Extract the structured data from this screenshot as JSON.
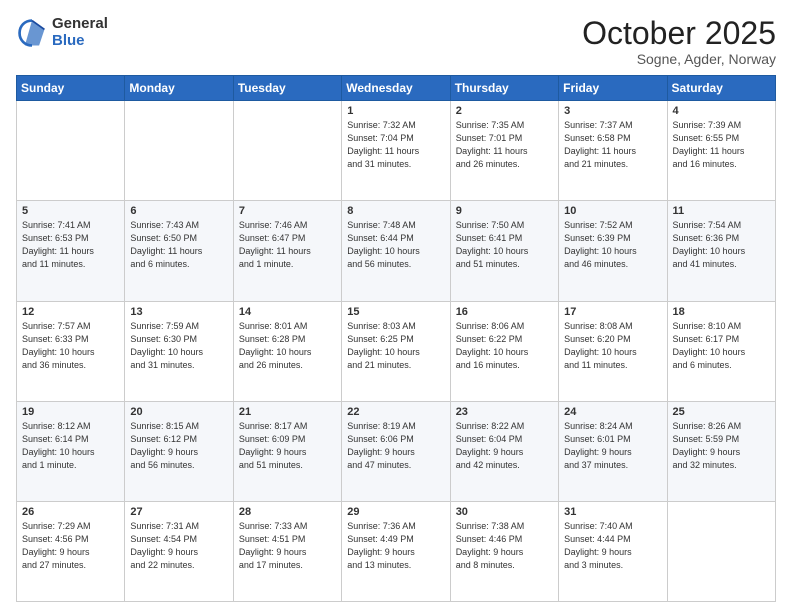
{
  "logo": {
    "general": "General",
    "blue": "Blue"
  },
  "header": {
    "month": "October 2025",
    "location": "Sogne, Agder, Norway"
  },
  "days_of_week": [
    "Sunday",
    "Monday",
    "Tuesday",
    "Wednesday",
    "Thursday",
    "Friday",
    "Saturday"
  ],
  "weeks": [
    [
      {
        "day": "",
        "info": ""
      },
      {
        "day": "",
        "info": ""
      },
      {
        "day": "",
        "info": ""
      },
      {
        "day": "1",
        "info": "Sunrise: 7:32 AM\nSunset: 7:04 PM\nDaylight: 11 hours\nand 31 minutes."
      },
      {
        "day": "2",
        "info": "Sunrise: 7:35 AM\nSunset: 7:01 PM\nDaylight: 11 hours\nand 26 minutes."
      },
      {
        "day": "3",
        "info": "Sunrise: 7:37 AM\nSunset: 6:58 PM\nDaylight: 11 hours\nand 21 minutes."
      },
      {
        "day": "4",
        "info": "Sunrise: 7:39 AM\nSunset: 6:55 PM\nDaylight: 11 hours\nand 16 minutes."
      }
    ],
    [
      {
        "day": "5",
        "info": "Sunrise: 7:41 AM\nSunset: 6:53 PM\nDaylight: 11 hours\nand 11 minutes."
      },
      {
        "day": "6",
        "info": "Sunrise: 7:43 AM\nSunset: 6:50 PM\nDaylight: 11 hours\nand 6 minutes."
      },
      {
        "day": "7",
        "info": "Sunrise: 7:46 AM\nSunset: 6:47 PM\nDaylight: 11 hours\nand 1 minute."
      },
      {
        "day": "8",
        "info": "Sunrise: 7:48 AM\nSunset: 6:44 PM\nDaylight: 10 hours\nand 56 minutes."
      },
      {
        "day": "9",
        "info": "Sunrise: 7:50 AM\nSunset: 6:41 PM\nDaylight: 10 hours\nand 51 minutes."
      },
      {
        "day": "10",
        "info": "Sunrise: 7:52 AM\nSunset: 6:39 PM\nDaylight: 10 hours\nand 46 minutes."
      },
      {
        "day": "11",
        "info": "Sunrise: 7:54 AM\nSunset: 6:36 PM\nDaylight: 10 hours\nand 41 minutes."
      }
    ],
    [
      {
        "day": "12",
        "info": "Sunrise: 7:57 AM\nSunset: 6:33 PM\nDaylight: 10 hours\nand 36 minutes."
      },
      {
        "day": "13",
        "info": "Sunrise: 7:59 AM\nSunset: 6:30 PM\nDaylight: 10 hours\nand 31 minutes."
      },
      {
        "day": "14",
        "info": "Sunrise: 8:01 AM\nSunset: 6:28 PM\nDaylight: 10 hours\nand 26 minutes."
      },
      {
        "day": "15",
        "info": "Sunrise: 8:03 AM\nSunset: 6:25 PM\nDaylight: 10 hours\nand 21 minutes."
      },
      {
        "day": "16",
        "info": "Sunrise: 8:06 AM\nSunset: 6:22 PM\nDaylight: 10 hours\nand 16 minutes."
      },
      {
        "day": "17",
        "info": "Sunrise: 8:08 AM\nSunset: 6:20 PM\nDaylight: 10 hours\nand 11 minutes."
      },
      {
        "day": "18",
        "info": "Sunrise: 8:10 AM\nSunset: 6:17 PM\nDaylight: 10 hours\nand 6 minutes."
      }
    ],
    [
      {
        "day": "19",
        "info": "Sunrise: 8:12 AM\nSunset: 6:14 PM\nDaylight: 10 hours\nand 1 minute."
      },
      {
        "day": "20",
        "info": "Sunrise: 8:15 AM\nSunset: 6:12 PM\nDaylight: 9 hours\nand 56 minutes."
      },
      {
        "day": "21",
        "info": "Sunrise: 8:17 AM\nSunset: 6:09 PM\nDaylight: 9 hours\nand 51 minutes."
      },
      {
        "day": "22",
        "info": "Sunrise: 8:19 AM\nSunset: 6:06 PM\nDaylight: 9 hours\nand 47 minutes."
      },
      {
        "day": "23",
        "info": "Sunrise: 8:22 AM\nSunset: 6:04 PM\nDaylight: 9 hours\nand 42 minutes."
      },
      {
        "day": "24",
        "info": "Sunrise: 8:24 AM\nSunset: 6:01 PM\nDaylight: 9 hours\nand 37 minutes."
      },
      {
        "day": "25",
        "info": "Sunrise: 8:26 AM\nSunset: 5:59 PM\nDaylight: 9 hours\nand 32 minutes."
      }
    ],
    [
      {
        "day": "26",
        "info": "Sunrise: 7:29 AM\nSunset: 4:56 PM\nDaylight: 9 hours\nand 27 minutes."
      },
      {
        "day": "27",
        "info": "Sunrise: 7:31 AM\nSunset: 4:54 PM\nDaylight: 9 hours\nand 22 minutes."
      },
      {
        "day": "28",
        "info": "Sunrise: 7:33 AM\nSunset: 4:51 PM\nDaylight: 9 hours\nand 17 minutes."
      },
      {
        "day": "29",
        "info": "Sunrise: 7:36 AM\nSunset: 4:49 PM\nDaylight: 9 hours\nand 13 minutes."
      },
      {
        "day": "30",
        "info": "Sunrise: 7:38 AM\nSunset: 4:46 PM\nDaylight: 9 hours\nand 8 minutes."
      },
      {
        "day": "31",
        "info": "Sunrise: 7:40 AM\nSunset: 4:44 PM\nDaylight: 9 hours\nand 3 minutes."
      },
      {
        "day": "",
        "info": ""
      }
    ]
  ]
}
